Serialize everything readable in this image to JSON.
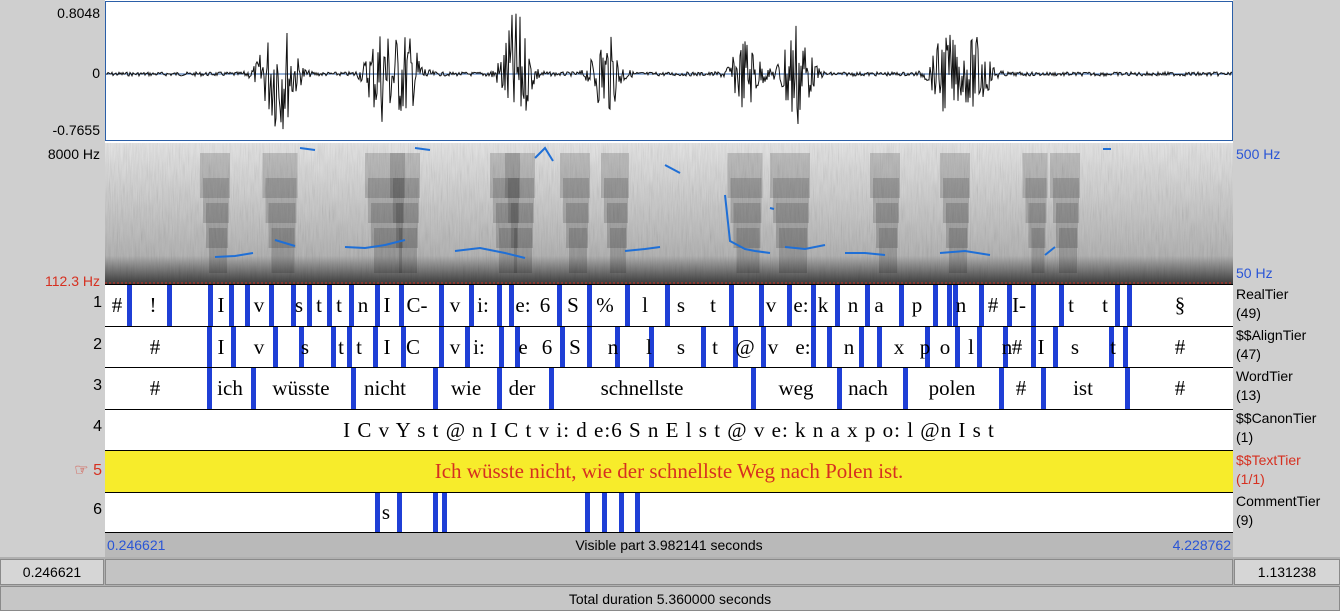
{
  "waveform": {
    "max_label": "0.8048",
    "zero_label": "0",
    "min_label": "-0.7655"
  },
  "spectrogram": {
    "freq_top_label": "8000 Hz",
    "freq_bottom_label": "112.3 Hz",
    "pitch_top_label": "500 Hz",
    "pitch_bottom_label": "50 Hz"
  },
  "tiers": [
    {
      "number": "1",
      "name": "RealTier",
      "count": "(49)"
    },
    {
      "number": "2",
      "name": "$$AlignTier",
      "count": "(47)"
    },
    {
      "number": "3",
      "name": "WordTier",
      "count": "(13)"
    },
    {
      "number": "4",
      "name": "$$CanonTier",
      "count": "(1)"
    },
    {
      "number": "5",
      "name": "$$TextTier",
      "count": "(1/1)",
      "pointer": "☞"
    },
    {
      "number": "6",
      "name": "CommentTier",
      "count": "(9)"
    }
  ],
  "tier1_labels": [
    "#",
    "!",
    "I",
    "v",
    "s",
    "t",
    "t",
    "n",
    "I",
    "C-",
    "v",
    "i:",
    "e:",
    "6",
    "S",
    "%",
    "l",
    "s",
    "t",
    "v",
    "e:",
    "k",
    "n",
    "a",
    "p",
    "n",
    "#",
    "I-",
    "t",
    "t",
    "§"
  ],
  "tier2_labels": [
    "#",
    "I",
    "v",
    "s",
    "t",
    "t",
    "I",
    "C",
    "v",
    "i:",
    "e",
    "6",
    "S",
    "n",
    "l",
    "s",
    "t",
    "@",
    "v",
    "e:",
    "n",
    "x",
    "p",
    "o",
    "l",
    "n",
    "#",
    "I",
    "s",
    "t",
    "#"
  ],
  "tier3_labels": [
    "#",
    "ich",
    "wüsste",
    "nicht",
    "wie",
    "der",
    "schnellste",
    "weg",
    "nach",
    "polen",
    "#",
    "ist",
    "#"
  ],
  "tier4_text": "I C   v Y s t @   n I C t   v i:   d e:6   S n E l s t @   v e: k   n a x   p o: l @n   I s t",
  "tier5_text": "Ich wüsste nicht, wie der schnellste Weg nach Polen ist.",
  "tier6_labels": [
    "s"
  ],
  "nav": {
    "start_time": "0.246621",
    "visible_part": "Visible part 3.982141 seconds",
    "end_time": "4.228762"
  },
  "bottom": {
    "left_value": "0.246621",
    "right_value": "1.131238",
    "total_duration": "Total duration 5.360000 seconds"
  },
  "colors": {
    "boundary": "#1f3fd6",
    "pitch": "#1f6fd6",
    "selected_tier": "#f7ec2b",
    "selected_text": "#d63020",
    "time_blue": "#2a55d6"
  }
}
